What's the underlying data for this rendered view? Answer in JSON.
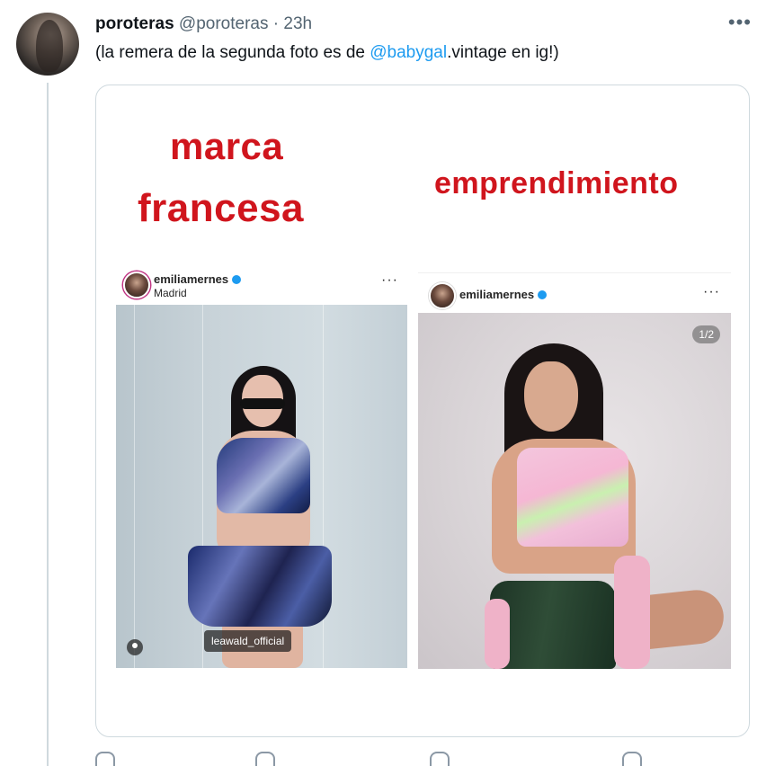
{
  "tweet": {
    "author_name": "poroteras",
    "handle": "@poroteras",
    "separator": "·",
    "time": "23h",
    "more_label": "•••",
    "text_before": "(la remera de la segunda foto es de ",
    "mention": "@babygal",
    "text_after": ".vintage en ig!)"
  },
  "media": {
    "label_marca": "marca",
    "label_francesa": "francesa",
    "label_emprendimiento": "emprendimiento",
    "left_post": {
      "username": "emiliamernes",
      "location": "Madrid",
      "more_label": "···",
      "tag": "leawald_official"
    },
    "right_post": {
      "username": "emiliamernes",
      "more_label": "···",
      "counter": "1/2"
    },
    "label_color": "#d0151d"
  },
  "icons": [
    "more-icon",
    "verified-icon",
    "person-tag-icon"
  ]
}
